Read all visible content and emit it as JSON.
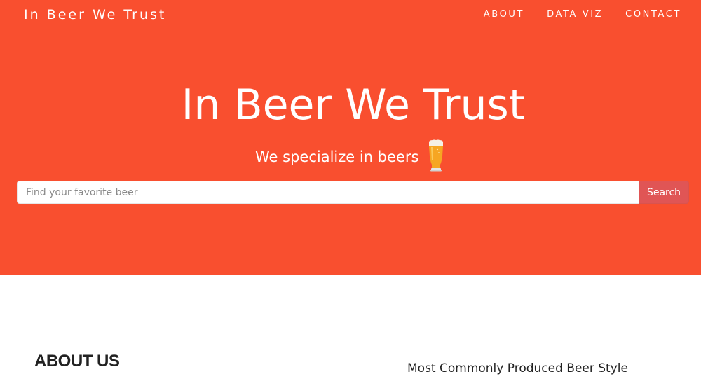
{
  "brand": "In Beer We Trust",
  "nav": {
    "items": [
      {
        "label": "ABOUT"
      },
      {
        "label": "DATA VIZ"
      },
      {
        "label": "CONTACT"
      }
    ]
  },
  "hero": {
    "title": "In Beer We Trust",
    "tagline": "We specialize in beers",
    "tagline_icon": "beer-glass-icon",
    "background_color": "#f94f2f"
  },
  "search": {
    "placeholder": "Find your favorite beer",
    "value": "",
    "button_label": "Search",
    "button_color": "#e05555"
  },
  "about": {
    "heading": "ABOUT US"
  },
  "chart_section": {
    "title": "Most Commonly Produced Beer Style"
  }
}
